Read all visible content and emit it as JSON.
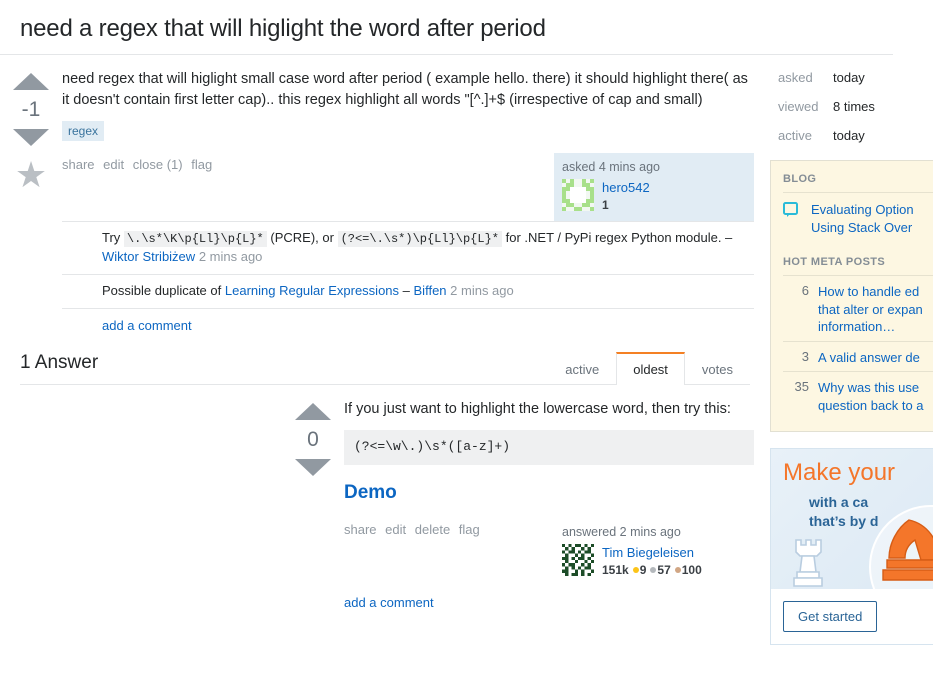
{
  "question": {
    "title": "need a regex that will higlight the word after period",
    "vote_score": "-1",
    "body": "need regex that will higlight small case word after period ( example hello. there) it should highlight there( as it doesn't contain first letter cap).. this regex highlight all words \"[^.]+$ (irrespective of cap and small)",
    "tags": [
      "regex"
    ],
    "menu": {
      "share": "share",
      "edit": "edit",
      "close": "close (1)",
      "flag": "flag"
    },
    "owner": {
      "action": "asked 4 mins ago",
      "name": "hero542",
      "reputation": "1"
    },
    "comments": [
      {
        "text_before": "Try",
        "code1": "\\.\\s*\\K\\p{Ll}\\p{L}*",
        "text_mid": "(PCRE), or",
        "code2": "(?<=\\.\\s*)\\p{Ll}\\p{L}*",
        "text_after": "for .NET / PyPi regex Python module. –",
        "author": "Wiktor Stribiżew",
        "age": "2 mins ago"
      },
      {
        "text_before": "Possible duplicate of",
        "link": "Learning Regular Expressions",
        "dash": "–",
        "author": "Biffen",
        "age": "2 mins ago"
      }
    ],
    "add_comment": "add a comment"
  },
  "answers_header": {
    "count_label": "1 Answer",
    "tabs": [
      {
        "label": "active",
        "selected": false
      },
      {
        "label": "oldest",
        "selected": true
      },
      {
        "label": "votes",
        "selected": false
      }
    ]
  },
  "answer": {
    "vote_score": "0",
    "body_text": "If you just want to highlight the lowercase word, then try this:",
    "code": "(?<=\\w\\.)\\s*([a-z]+)",
    "demo_link": "Demo",
    "menu": {
      "share": "share",
      "edit": "edit",
      "delete": "delete",
      "flag": "flag"
    },
    "owner": {
      "action": "answered 2 mins ago",
      "name": "Tim Biegeleisen",
      "reputation": "151k",
      "gold": "9",
      "silver": "57",
      "bronze": "100"
    },
    "add_comment": "add a comment"
  },
  "sidebar": {
    "stats": [
      {
        "label": "asked",
        "value": "today"
      },
      {
        "label": "viewed",
        "value": "8 times"
      },
      {
        "label": "active",
        "value": "today"
      }
    ],
    "blog": {
      "heading": "BLOG",
      "item_line1": "Evaluating Option",
      "item_line2": "Using Stack Over"
    },
    "hot_meta": {
      "heading": "HOT META POSTS",
      "posts": [
        {
          "score": "6",
          "line1": "How to handle ed",
          "line2": "that alter or expan",
          "line3": "information…"
        },
        {
          "score": "3",
          "line1": "A valid answer de",
          "line2": "",
          "line3": ""
        },
        {
          "score": "35",
          "line1": "Why was this use",
          "line2": "question back to a",
          "line3": ""
        }
      ]
    },
    "ad": {
      "headline": "Make your",
      "sub_line1": "with a ca",
      "sub_line2": "that’s by d",
      "cta": "Get started"
    }
  },
  "colors": {
    "accent_orange": "#f48024",
    "link_blue": "#0c66c2",
    "tag_bg": "#e1ecf4",
    "tag_text": "#39739d",
    "usercard_bg": "#e1ecf4",
    "code_bg": "#eff0f1",
    "panel_yellow": "#fdf7e2",
    "gold": "#fcc419",
    "silver": "#b4b8bc",
    "bronze": "#d1a684"
  }
}
